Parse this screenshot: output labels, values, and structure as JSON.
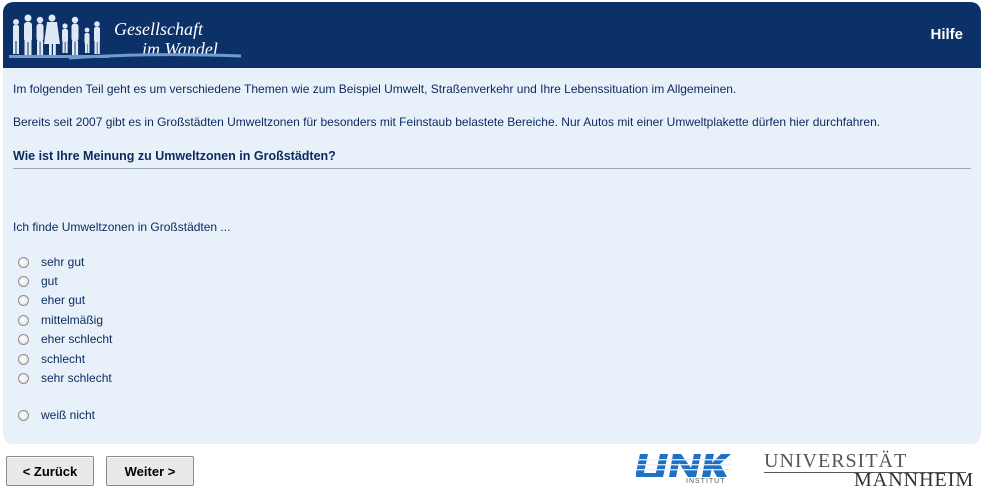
{
  "header": {
    "logo_line1": "Gesellschaft",
    "logo_line2": "im Wandel",
    "help_label": "Hilfe",
    "colors": {
      "header_bg": "#0c3068",
      "content_bg": "#e8f0fa"
    }
  },
  "content": {
    "intro1": "Im folgenden Teil geht es um verschiedene Themen wie zum Beispiel Umwelt, Straßenverkehr und Ihre Lebenssituation im Allgemeinen.",
    "intro2": "Bereits seit 2007 gibt es in Großstädten Umweltzonen für besonders mit Feinstaub belastete Bereiche. Nur Autos mit einer Umweltplakette dürfen hier durchfahren.",
    "question": "Wie ist Ihre Meinung zu Umweltzonen in Großstädten?",
    "stem": "Ich finde Umweltzonen in Großstädten ...",
    "options": [
      {
        "label": "sehr gut",
        "selected": false
      },
      {
        "label": "gut",
        "selected": false
      },
      {
        "label": "eher gut",
        "selected": false
      },
      {
        "label": "mittelmäßig",
        "selected": false
      },
      {
        "label": "eher schlecht",
        "selected": false
      },
      {
        "label": "schlecht",
        "selected": false
      },
      {
        "label": "sehr schlecht",
        "selected": false
      },
      {
        "label": "weiß nicht",
        "selected": false
      }
    ]
  },
  "nav": {
    "back_label": "< Zurück",
    "next_label": "Weiter >"
  },
  "logos": {
    "link_name": "LINK",
    "link_sub": "INSTITUT",
    "uni_line1": "UNIVERSITÄT",
    "uni_line2": "MANNHEIM"
  }
}
